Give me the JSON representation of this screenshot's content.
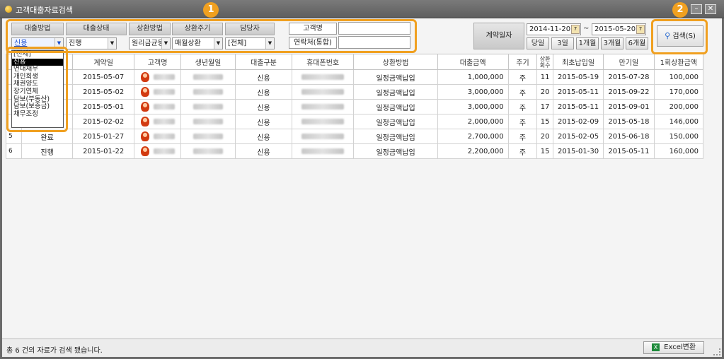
{
  "window": {
    "title": "고객대출자료검색",
    "min_icon": "minimize-icon",
    "close_icon": "close-icon"
  },
  "filters": {
    "headers": [
      "대출방법",
      "대출상태",
      "상환방법",
      "상환주기",
      "담당자"
    ],
    "values": [
      "신용",
      "진행",
      "원리금균등",
      "매월상환",
      "[전체]"
    ],
    "customer_label": "고객명",
    "customer_value": "",
    "contact_label": "연락처(통합)",
    "contact_value": ""
  },
  "dropdown": {
    "options": [
      "[전체]",
      "신용",
      "연대채무",
      "개인회생",
      "채권양도",
      "장기연체",
      "담보(부동산)",
      "담보(보증금)",
      "채무조정"
    ],
    "selected_index": 1
  },
  "date": {
    "label": "계약일자",
    "from": "2014-11-20",
    "to": "2015-05-20",
    "tilde": "~",
    "quick": [
      "당일",
      "3일",
      "1개월",
      "3개월",
      "6개월"
    ]
  },
  "search": {
    "label": "검색(S)"
  },
  "badges": [
    "1",
    "2"
  ],
  "table": {
    "columns": [
      "",
      "",
      "계약일",
      "고객명",
      "생년월일",
      "대출구분",
      "휴대폰번호",
      "상환방법",
      "대출금액",
      "주기",
      "상환회수",
      "최초납입일",
      "만기일",
      "1회상환금액"
    ],
    "rows": [
      {
        "idx": "",
        "status": "",
        "date": "2015-05-07",
        "type": "신용",
        "method": "일정금액납입",
        "amount": "1,000,000",
        "cycle": "주",
        "count": "11",
        "first": "2015-05-19",
        "due": "2015-07-28",
        "pay": "100,000"
      },
      {
        "idx": "",
        "status": "",
        "date": "2015-05-02",
        "type": "신용",
        "method": "일정금액납입",
        "amount": "3,000,000",
        "cycle": "주",
        "count": "20",
        "first": "2015-05-11",
        "due": "2015-09-22",
        "pay": "170,000"
      },
      {
        "idx": "",
        "status": "",
        "date": "2015-05-01",
        "type": "신용",
        "method": "일정금액납입",
        "amount": "3,000,000",
        "cycle": "주",
        "count": "17",
        "first": "2015-05-11",
        "due": "2015-09-01",
        "pay": "200,000"
      },
      {
        "idx": "",
        "status": "",
        "date": "2015-02-02",
        "type": "신용",
        "method": "일정금액납입",
        "amount": "2,000,000",
        "cycle": "주",
        "count": "15",
        "first": "2015-02-09",
        "due": "2015-05-18",
        "pay": "146,000"
      },
      {
        "idx": "5",
        "status": "완료",
        "date": "2015-01-27",
        "type": "신용",
        "method": "일정금액납입",
        "amount": "2,700,000",
        "cycle": "주",
        "count": "20",
        "first": "2015-02-05",
        "due": "2015-06-18",
        "pay": "150,000"
      },
      {
        "idx": "6",
        "status": "진행",
        "date": "2015-01-22",
        "type": "신용",
        "method": "일정금액납입",
        "amount": "2,200,000",
        "cycle": "주",
        "count": "15",
        "first": "2015-01-30",
        "due": "2015-05-11",
        "pay": "160,000"
      }
    ]
  },
  "status": {
    "message": "총 6 건의 자료가 검색 됐습니다.",
    "excel_label": "Excel변환",
    "excel_icon": "excel-icon",
    "excel_icon_glyph": "X"
  },
  "colors": {
    "highlight": "#f0a020",
    "selected_bg": "#000000"
  }
}
